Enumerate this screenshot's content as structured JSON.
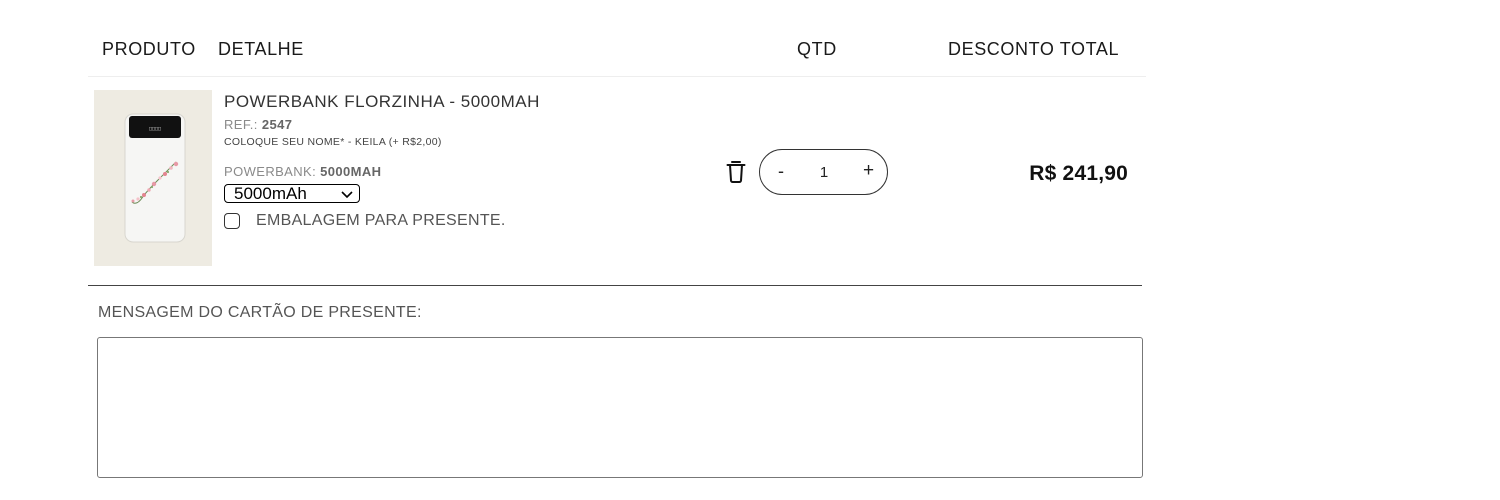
{
  "table_header": {
    "produto": "PRODUTO",
    "detalhe": "DETALHE",
    "qtd": "QTD",
    "desconto_total": "DESCONTO TOTAL"
  },
  "item": {
    "name": "POWERBANK FLORZINHA - 5000MAH",
    "ref_label": "REF.:",
    "ref_value": "2547",
    "customization": "COLOQUE SEU NOME* - KEILA (+ R$2,00)",
    "variant_label": "POWERBANK:",
    "variant_value": "5000MAH",
    "variant_select": "5000mAh",
    "gift_wrap_label": "EMBALAGEM PARA PRESENTE.",
    "gift_wrap_checked": false,
    "quantity": "1",
    "minus": "-",
    "plus": "+",
    "total": "R$ 241,90",
    "device_screen_text": "□□□□"
  },
  "gift_message": {
    "label": "MENSAGEM DO CARTÃO DE PRESENTE:",
    "value": ""
  },
  "colors": {
    "image_background": "#eeebe2",
    "divider": "#444444"
  }
}
